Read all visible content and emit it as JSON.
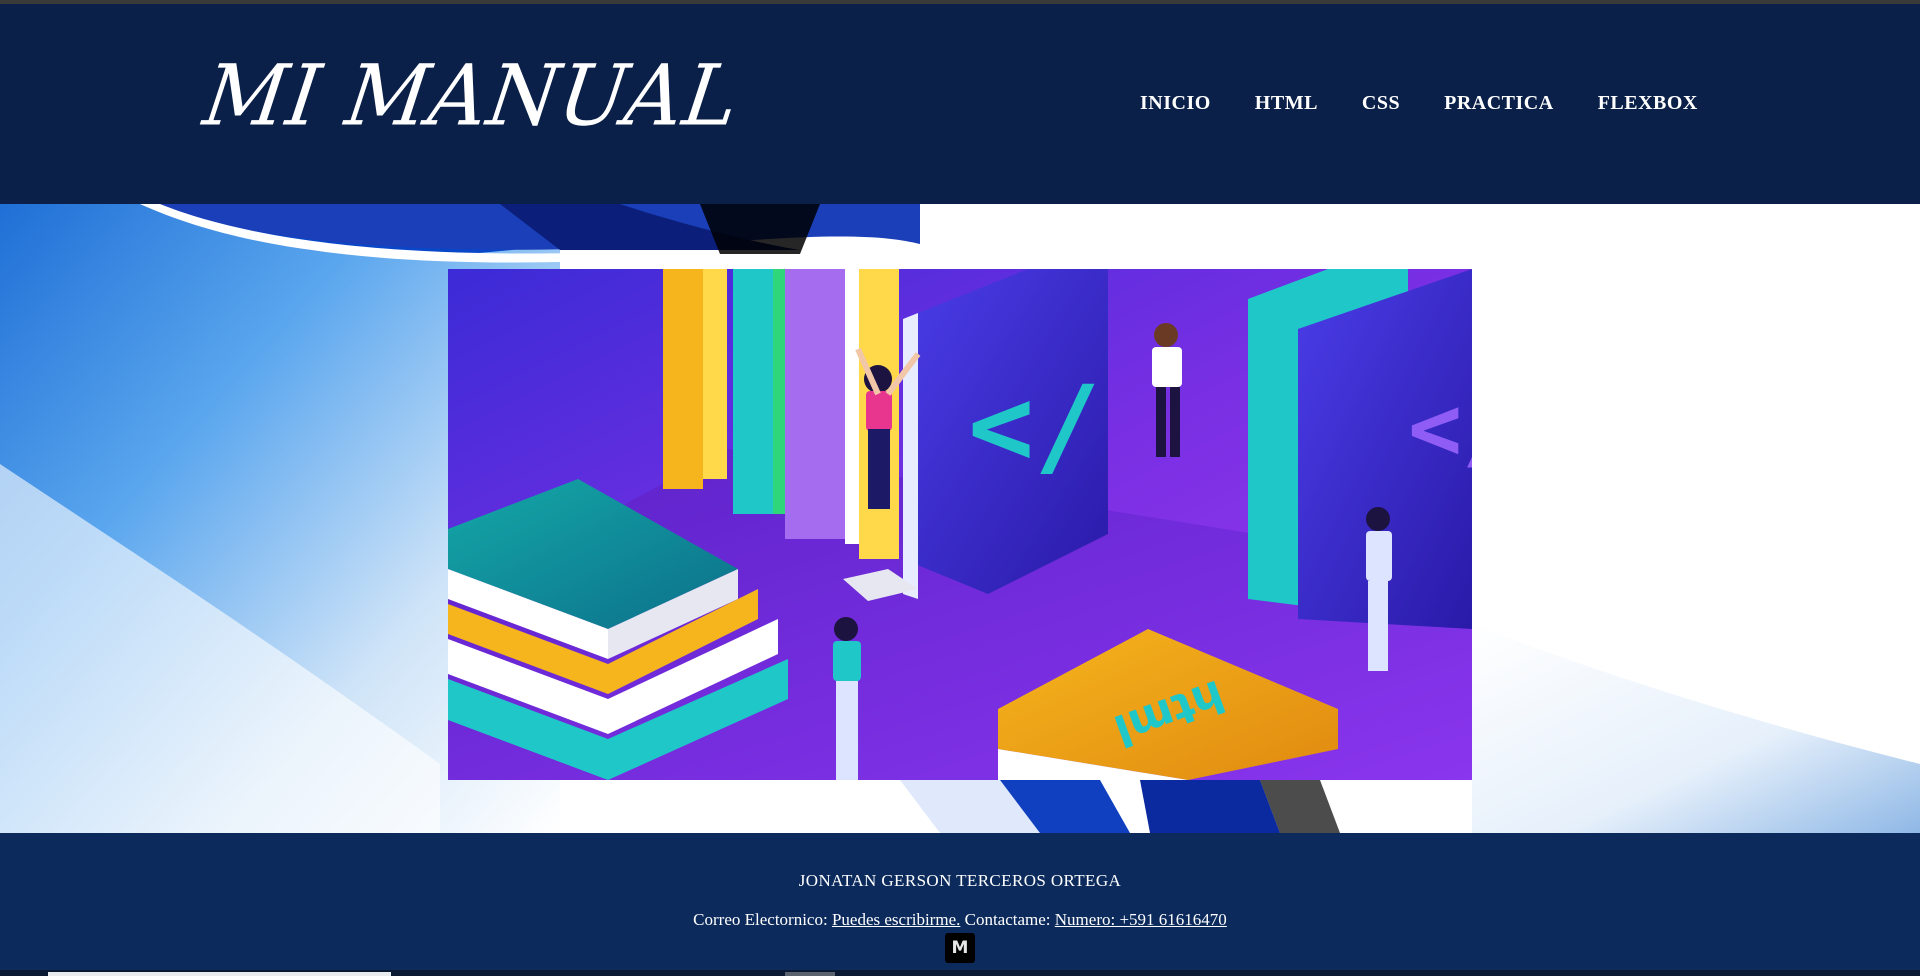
{
  "brand": {
    "title": "MI MANUAL"
  },
  "nav": {
    "items": [
      {
        "label": "INICIO"
      },
      {
        "label": "HTML"
      },
      {
        "label": "CSS"
      },
      {
        "label": "PRACTICA"
      },
      {
        "label": "FLEXBOX"
      }
    ]
  },
  "hero": {
    "illustration": {
      "code_symbol_left": "</",
      "code_symbol_right": "</",
      "book_label": "html"
    }
  },
  "footer": {
    "author": "JONATAN GERSON TERCEROS ORTEGA",
    "email_label": "Correo Electornico: ",
    "email_link": "Puedes escribirme.",
    "contact_label": " Contactame: ",
    "phone_link": "Numero: +591 61616470",
    "badge": "M"
  },
  "colors": {
    "header_bg": "#0b2049",
    "footer_bg": "#0c2b5c",
    "illustration_bg": "#7b2fe0",
    "accent_teal": "#1fc7c9",
    "accent_yellow": "#f6b51d"
  }
}
